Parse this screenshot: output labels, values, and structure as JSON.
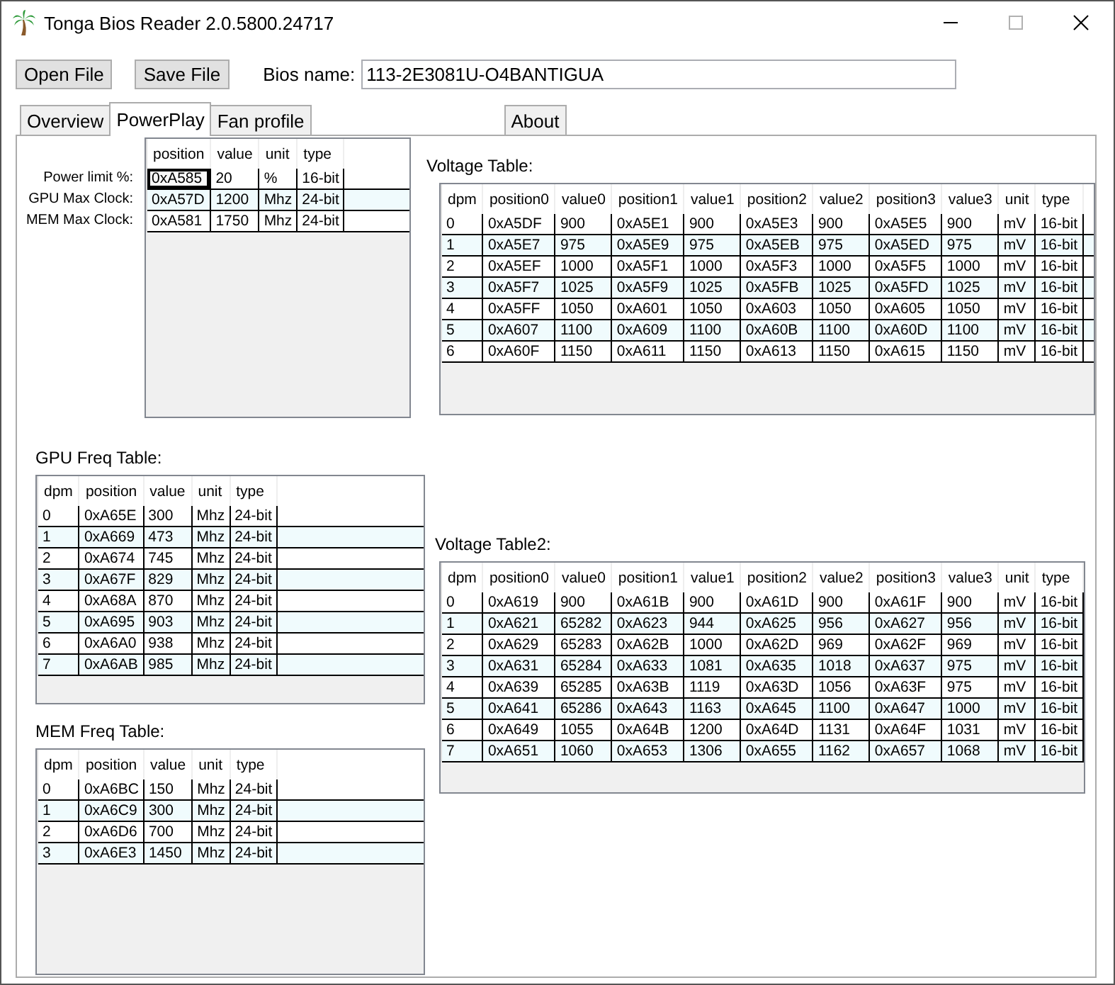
{
  "window": {
    "title": "Tonga Bios Reader 2.0.5800.24717",
    "maximize_disabled": true
  },
  "toolbar": {
    "buttons": [
      "Open File",
      "Save File"
    ],
    "bios_label": "Bios name:",
    "bios_value": "113-2E3081U-O4BANTIGUA"
  },
  "tabs": [
    {
      "label": "Overview",
      "selected": false
    },
    {
      "label": "PowerPlay",
      "selected": true
    },
    {
      "label": "Fan profile",
      "selected": false
    },
    {
      "label": "About",
      "selected": false
    }
  ],
  "limits": {
    "labels": [
      "Power limit %:",
      "GPU Max Clock:",
      "MEM Max Clock:"
    ],
    "columns": [
      "position",
      "value",
      "unit",
      "type"
    ],
    "rows": [
      {
        "cells": [
          "0xA585",
          "20",
          "%",
          "16-bit"
        ],
        "focused": true
      },
      {
        "cells": [
          "0xA57D",
          "1200",
          "Mhz",
          "24-bit"
        ],
        "focused": false
      },
      {
        "cells": [
          "0xA581",
          "1750",
          "Mhz",
          "24-bit"
        ],
        "focused": false
      }
    ]
  },
  "gpu_freq_table": {
    "title": "GPU Freq Table:",
    "columns": [
      "dpm",
      "position",
      "value",
      "unit",
      "type"
    ],
    "rows": [
      [
        "0",
        "0xA65E",
        "300",
        "Mhz",
        "24-bit"
      ],
      [
        "1",
        "0xA669",
        "473",
        "Mhz",
        "24-bit"
      ],
      [
        "2",
        "0xA674",
        "745",
        "Mhz",
        "24-bit"
      ],
      [
        "3",
        "0xA67F",
        "829",
        "Mhz",
        "24-bit"
      ],
      [
        "4",
        "0xA68A",
        "870",
        "Mhz",
        "24-bit"
      ],
      [
        "5",
        "0xA695",
        "903",
        "Mhz",
        "24-bit"
      ],
      [
        "6",
        "0xA6A0",
        "938",
        "Mhz",
        "24-bit"
      ],
      [
        "7",
        "0xA6AB",
        "985",
        "Mhz",
        "24-bit"
      ]
    ]
  },
  "mem_freq_table": {
    "title": "MEM Freq Table:",
    "columns": [
      "dpm",
      "position",
      "value",
      "unit",
      "type"
    ],
    "rows": [
      [
        "0",
        "0xA6BC",
        "150",
        "Mhz",
        "24-bit"
      ],
      [
        "1",
        "0xA6C9",
        "300",
        "Mhz",
        "24-bit"
      ],
      [
        "2",
        "0xA6D6",
        "700",
        "Mhz",
        "24-bit"
      ],
      [
        "3",
        "0xA6E3",
        "1450",
        "Mhz",
        "24-bit"
      ]
    ]
  },
  "voltage_table": {
    "title": "Voltage Table:",
    "columns": [
      "dpm",
      "position0",
      "value0",
      "position1",
      "value1",
      "position2",
      "value2",
      "position3",
      "value3",
      "unit",
      "type"
    ],
    "rows": [
      [
        "0",
        "0xA5DF",
        "900",
        "0xA5E1",
        "900",
        "0xA5E3",
        "900",
        "0xA5E5",
        "900",
        "mV",
        "16-bit"
      ],
      [
        "1",
        "0xA5E7",
        "975",
        "0xA5E9",
        "975",
        "0xA5EB",
        "975",
        "0xA5ED",
        "975",
        "mV",
        "16-bit"
      ],
      [
        "2",
        "0xA5EF",
        "1000",
        "0xA5F1",
        "1000",
        "0xA5F3",
        "1000",
        "0xA5F5",
        "1000",
        "mV",
        "16-bit"
      ],
      [
        "3",
        "0xA5F7",
        "1025",
        "0xA5F9",
        "1025",
        "0xA5FB",
        "1025",
        "0xA5FD",
        "1025",
        "mV",
        "16-bit"
      ],
      [
        "4",
        "0xA5FF",
        "1050",
        "0xA601",
        "1050",
        "0xA603",
        "1050",
        "0xA605",
        "1050",
        "mV",
        "16-bit"
      ],
      [
        "5",
        "0xA607",
        "1100",
        "0xA609",
        "1100",
        "0xA60B",
        "1100",
        "0xA60D",
        "1100",
        "mV",
        "16-bit"
      ],
      [
        "6",
        "0xA60F",
        "1150",
        "0xA611",
        "1150",
        "0xA613",
        "1150",
        "0xA615",
        "1150",
        "mV",
        "16-bit"
      ]
    ]
  },
  "voltage_table2": {
    "title": "Voltage Table2:",
    "columns": [
      "dpm",
      "position0",
      "value0",
      "position1",
      "value1",
      "position2",
      "value2",
      "position3",
      "value3",
      "unit",
      "type"
    ],
    "rows": [
      [
        "0",
        "0xA619",
        "900",
        "0xA61B",
        "900",
        "0xA61D",
        "900",
        "0xA61F",
        "900",
        "mV",
        "16-bit"
      ],
      [
        "1",
        "0xA621",
        "65282",
        "0xA623",
        "944",
        "0xA625",
        "956",
        "0xA627",
        "956",
        "mV",
        "16-bit"
      ],
      [
        "2",
        "0xA629",
        "65283",
        "0xA62B",
        "1000",
        "0xA62D",
        "969",
        "0xA62F",
        "969",
        "mV",
        "16-bit"
      ],
      [
        "3",
        "0xA631",
        "65284",
        "0xA633",
        "1081",
        "0xA635",
        "1018",
        "0xA637",
        "975",
        "mV",
        "16-bit"
      ],
      [
        "4",
        "0xA639",
        "65285",
        "0xA63B",
        "1119",
        "0xA63D",
        "1056",
        "0xA63F",
        "975",
        "mV",
        "16-bit"
      ],
      [
        "5",
        "0xA641",
        "65286",
        "0xA643",
        "1163",
        "0xA645",
        "1100",
        "0xA647",
        "1000",
        "mV",
        "16-bit"
      ],
      [
        "6",
        "0xA649",
        "1055",
        "0xA64B",
        "1200",
        "0xA64D",
        "1131",
        "0xA64F",
        "1031",
        "mV",
        "16-bit"
      ],
      [
        "7",
        "0xA651",
        "1060",
        "0xA653",
        "1306",
        "0xA655",
        "1162",
        "0xA657",
        "1068",
        "mV",
        "16-bit"
      ]
    ]
  }
}
